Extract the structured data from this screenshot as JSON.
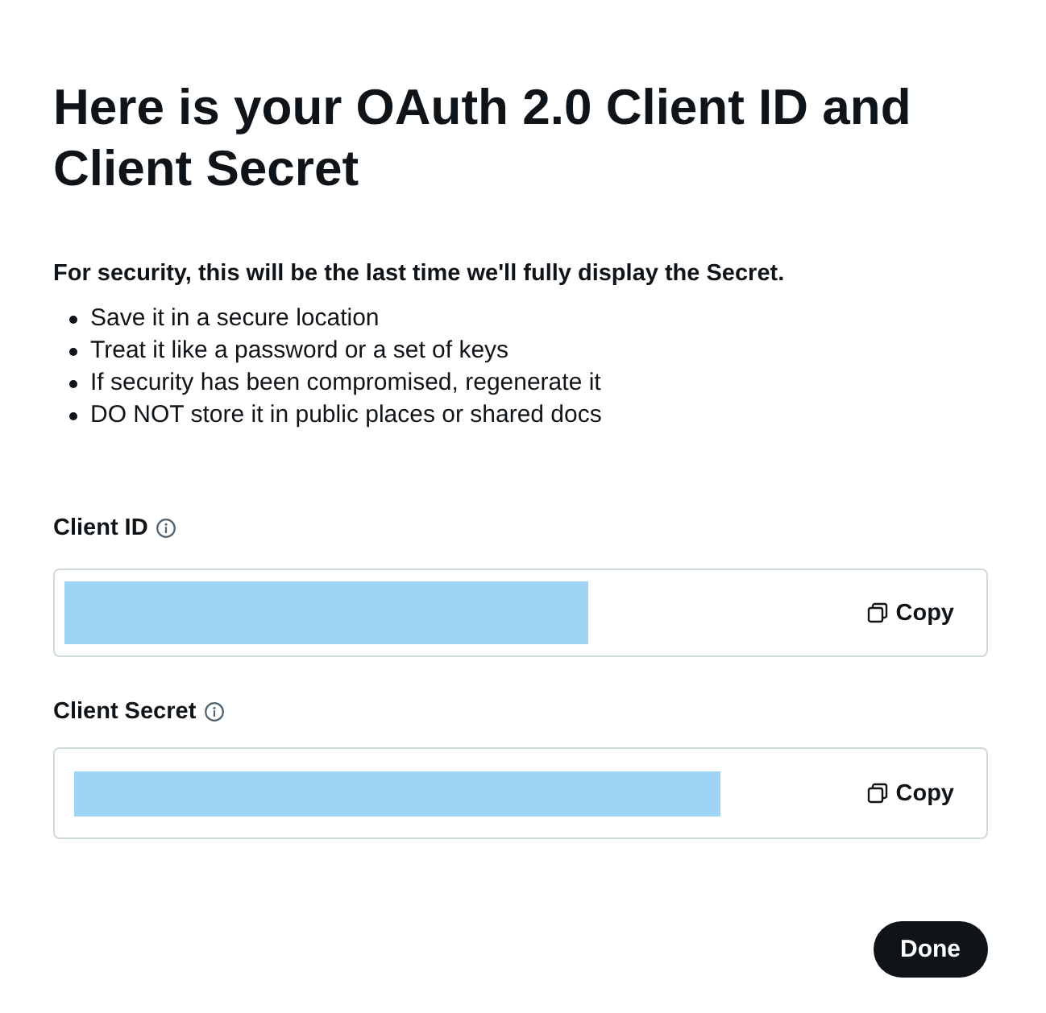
{
  "dialog": {
    "title": "Here is your OAuth 2.0 Client ID and Client Secret",
    "notice": "For security, this will be the last time we'll fully display the Secret.",
    "tips": [
      "Save it in a secure location",
      "Treat it like a password or a set of keys",
      "If security has been compromised, regenerate it",
      "DO NOT store it in public places or shared docs"
    ],
    "fields": [
      {
        "label": "Client ID",
        "copy_label": "Copy"
      },
      {
        "label": "Client Secret",
        "copy_label": "Copy"
      }
    ],
    "done_button": "Done"
  }
}
